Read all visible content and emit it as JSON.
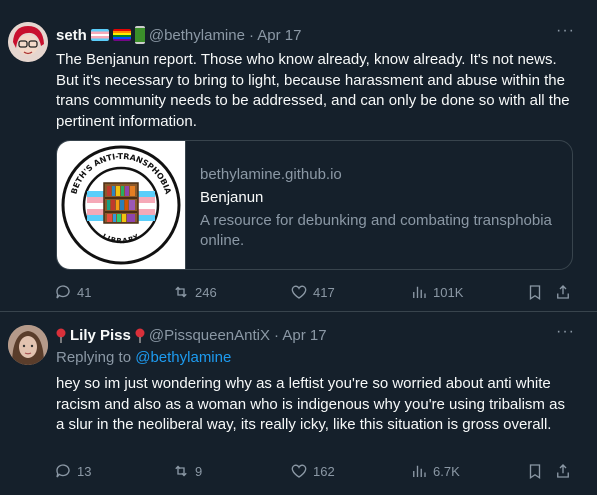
{
  "tweets": [
    {
      "name": "seth",
      "emoji": [
        "🏳️‍⚧️",
        "🏳️‍🌈",
        "🥫"
      ],
      "handle": "@bethylamine",
      "time": "· Apr 17",
      "text": "The Benjanun report. Those who know already, know already. It's not news. But it's necessary to bring to light, because harassment and abuse within the trans community needs to be addressed, and can only be done so with all the pertinent information.",
      "card": {
        "domain": "bethylamine.github.io",
        "title": "Benjanun",
        "description": "A resource for debunking and combating transphobia online.",
        "logo_top_text": "BETH'S ANTI-TRANSPHOBIA",
        "logo_bottom_text": "LIBRARY"
      },
      "stats": {
        "replies": "41",
        "reposts": "246",
        "likes": "417",
        "views": "101K"
      }
    },
    {
      "name": "Lily Piss",
      "handle": "@PissqueenAntiX",
      "time": "· Apr 17",
      "replying_label": "Replying to",
      "replying_to": "@bethylamine",
      "text": "hey so im just wondering why as a leftist you're so worried about anti white racism and also as a woman who is indigenous why you're using tribalism as a slur in the neoliberal way, its really icky, like this situation is gross overall.",
      "stats": {
        "replies": "13",
        "reposts": "9",
        "likes": "162",
        "views": "6.7K"
      }
    }
  ],
  "more_glyph": "···",
  "colors": {
    "background": "#15202b",
    "muted": "#8b98a5",
    "link": "#1d9bf0",
    "border": "#38444d"
  }
}
